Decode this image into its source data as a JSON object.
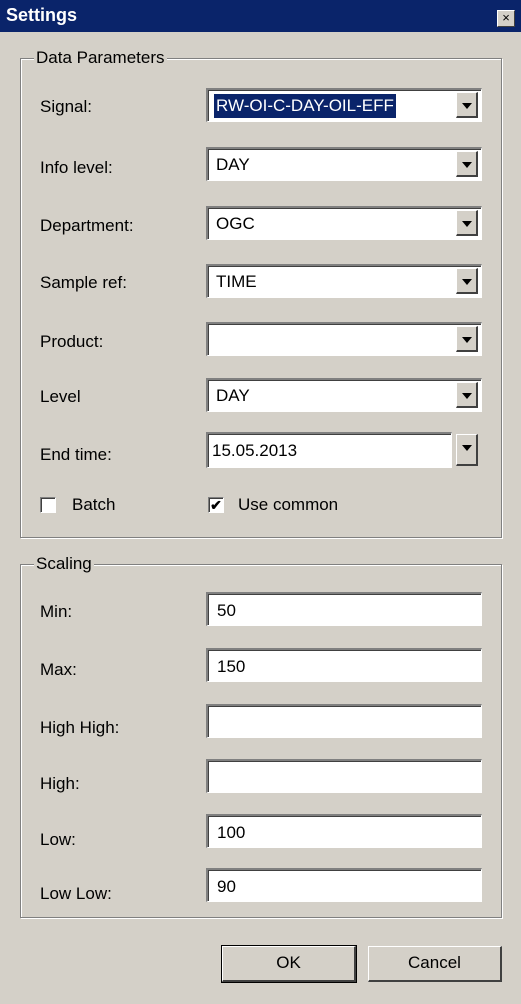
{
  "window": {
    "title": "Settings",
    "close_glyph": "×"
  },
  "data_parameters": {
    "legend": "Data Parameters",
    "signal": {
      "label": "Signal:",
      "value": "RW-OI-C-DAY-OIL-EFF"
    },
    "info_level": {
      "label": "Info level:",
      "value": "DAY"
    },
    "department": {
      "label": "Department:",
      "value": "OGC"
    },
    "sample_ref": {
      "label": "Sample ref:",
      "value": "TIME"
    },
    "product": {
      "label": "Product:",
      "value": ""
    },
    "level": {
      "label": "Level",
      "value": "DAY"
    },
    "end_time": {
      "label": "End time:",
      "value": "15.05.2013"
    },
    "batch": {
      "label": "Batch",
      "checked": false
    },
    "use_common": {
      "label": "Use common",
      "checked": true,
      "mark": "✔"
    }
  },
  "scaling": {
    "legend": "Scaling",
    "min": {
      "label": "Min:",
      "value": "50"
    },
    "max": {
      "label": "Max:",
      "value": "150"
    },
    "high_high": {
      "label": "High High:",
      "value": ""
    },
    "high": {
      "label": "High:",
      "value": ""
    },
    "low": {
      "label": "Low:",
      "value": "100"
    },
    "low_low": {
      "label": "Low Low:",
      "value": "90"
    }
  },
  "buttons": {
    "ok": "OK",
    "cancel": "Cancel"
  },
  "colors": {
    "titlebar": "#0a246a",
    "face": "#d4d0c8",
    "selection": "#0a246a"
  }
}
